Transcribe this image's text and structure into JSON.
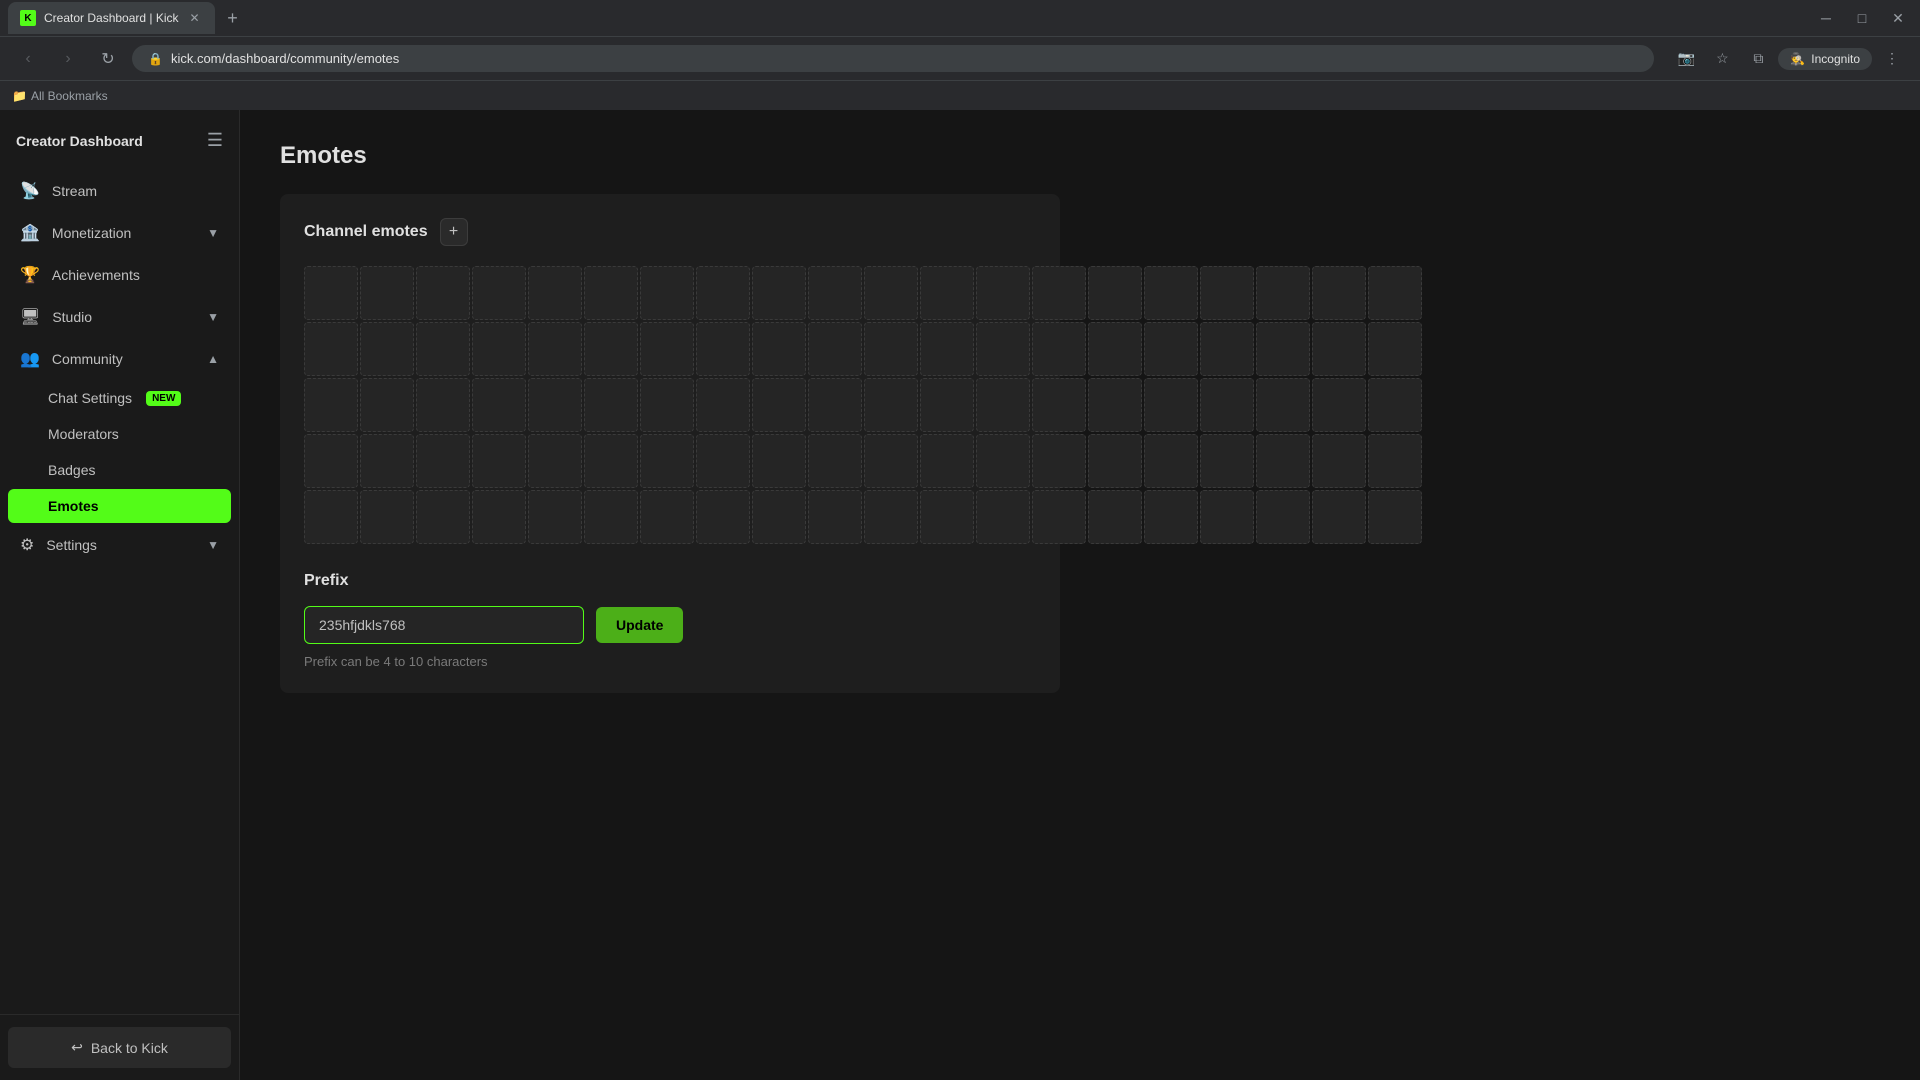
{
  "browser": {
    "tab_title": "Creator Dashboard | Kick",
    "tab_favicon": "K",
    "address": "kick.com/dashboard/community/emotes",
    "incognito_label": "Incognito",
    "bookmarks_label": "All Bookmarks"
  },
  "sidebar": {
    "title": "Creator Dashboard",
    "nav_items": [
      {
        "id": "stream",
        "label": "Stream",
        "icon": "📡",
        "has_chevron": false
      },
      {
        "id": "monetization",
        "label": "Monetization",
        "icon": "🏦",
        "has_chevron": true
      },
      {
        "id": "achievements",
        "label": "Achievements",
        "icon": "🏆",
        "has_chevron": false
      },
      {
        "id": "studio",
        "label": "Studio",
        "icon": "🖥",
        "has_chevron": true
      },
      {
        "id": "community",
        "label": "Community",
        "icon": "👥",
        "has_chevron": true,
        "expanded": true
      }
    ],
    "community_sub_items": [
      {
        "id": "chat-settings",
        "label": "Chat Settings",
        "is_new": true
      },
      {
        "id": "moderators",
        "label": "Moderators",
        "is_new": false
      },
      {
        "id": "badges",
        "label": "Badges",
        "is_new": false
      },
      {
        "id": "emotes",
        "label": "Emotes",
        "is_new": false,
        "active": true
      }
    ],
    "settings_item": {
      "label": "Settings",
      "icon": "⚙",
      "has_chevron": true
    },
    "back_to_kick_label": "Back to Kick"
  },
  "main": {
    "page_title": "Emotes",
    "channel_emotes_label": "Channel emotes",
    "add_button_label": "+",
    "emote_slots_count": 100,
    "prefix_section_label": "Prefix",
    "prefix_value": "235hfjdkls768",
    "prefix_placeholder": "235hfjdkls768",
    "update_button_label": "Update",
    "prefix_hint": "Prefix can be 4 to 10 characters"
  },
  "new_badge_label": "NEW"
}
